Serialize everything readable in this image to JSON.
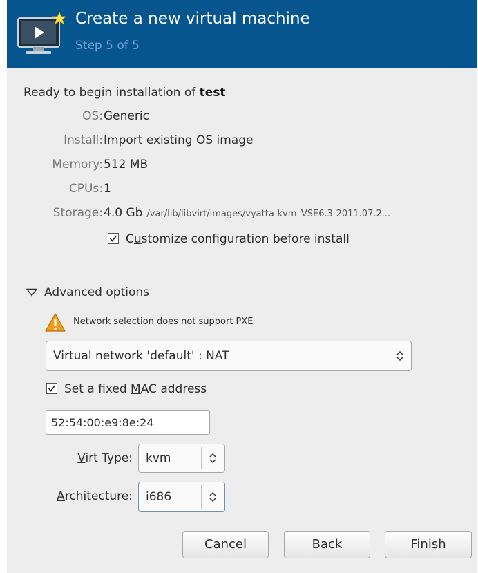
{
  "header": {
    "title": "Create a new virtual machine",
    "step": "Step 5 of 5",
    "icon": "virtual-machine-monitor-icon"
  },
  "summary": {
    "ready_prefix": "Ready to begin installation of ",
    "vm_name": "test",
    "rows": [
      {
        "label": "OS:",
        "value": "Generic"
      },
      {
        "label": "Install:",
        "value": "Import existing OS image"
      },
      {
        "label": "Memory:",
        "value": "512 MB"
      },
      {
        "label": "CPUs:",
        "value": "1"
      },
      {
        "label": "Storage:",
        "value": "4.0 Gb",
        "path": "/var/lib/libvirt/images/vyatta-kvm_VSE6.3-2011.07.2..."
      }
    ],
    "customize": {
      "label_before": "C",
      "label_mnemonic": "u",
      "label_after": "stomize configuration before install",
      "checked": true
    }
  },
  "advanced": {
    "label": "Advanced options",
    "expanded": true,
    "warning": "Network selection does not support PXE",
    "network": {
      "value": "Virtual network 'default' : NAT"
    },
    "fixed_mac": {
      "label_before": "Set a fixed ",
      "label_mnemonic": "M",
      "label_after": "AC address",
      "checked": true
    },
    "mac_value": "52:54:00:e9:8e:24",
    "virt_type": {
      "label_mnemonic": "V",
      "label_after": "irt Type:",
      "value": "kvm"
    },
    "architecture": {
      "label_mnemonic": "A",
      "label_after": "rchitecture:",
      "value": "i686"
    }
  },
  "buttons": {
    "cancel": {
      "mnemonic": "C",
      "rest": "ancel"
    },
    "back": {
      "mnemonic": "B",
      "rest": "ack"
    },
    "finish": {
      "mnemonic": "F",
      "rest": "inish"
    }
  },
  "colors": {
    "header_bg": "#07558f",
    "step_text": "#6fa3d1",
    "window_bg": "#ededed",
    "warning": "#f0a020"
  }
}
